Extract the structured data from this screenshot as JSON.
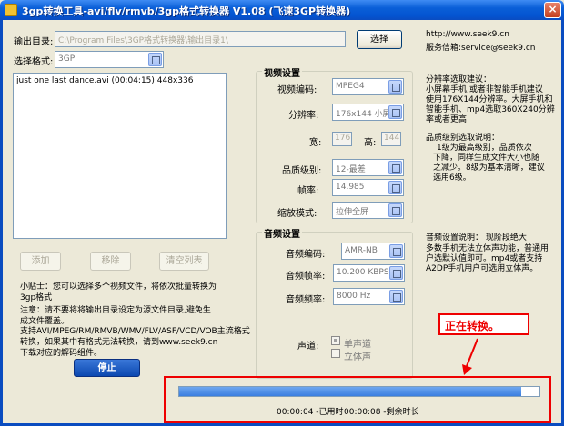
{
  "window": {
    "title": "3gp转换工具-avi/flv/rmvb/3gp格式转换器 V1.08 (飞速3GP转换器)",
    "close_glyph": "×"
  },
  "output": {
    "label": "输出目录:",
    "path": "C:\\Program Files\\3GP格式转换器\\输出目录1\\",
    "browse": "选择"
  },
  "site": {
    "url": "http://www.seek9.cn",
    "email": "服务信箱:service@seek9.cn"
  },
  "format": {
    "label": "选择格式:",
    "value": "3GP"
  },
  "files": [
    "just one last dance.avi (00:04:15) 448x336"
  ],
  "buttons": {
    "add": "添加",
    "remove": "移除",
    "clear": "清空列表",
    "stop": "停止"
  },
  "tips": {
    "line1": "小贴士：您可以选择多个视频文件，将依次批量转换为",
    "line2": "3gp格式",
    "line3": "注意：请不要将将输出目录设定为源文件目录,避免生",
    "line4": "成文件覆盖。",
    "line5": "支持AVI/MPEG/RM/RMVB/WMV/FLV/ASF/VCD/VOB主流格式",
    "line6": "转换，如果其中有格式无法转换，请到www.seek9.cn",
    "line7": "下载对应的解码组件。"
  },
  "video": {
    "title": "视频设置",
    "codec_label": "视频编码:",
    "codec": "MPEG4",
    "res_label": "分辨率:",
    "res": "176x144  小屏",
    "width_label": "宽:",
    "width": "176",
    "height_label": "高:",
    "height": "144",
    "quality_label": "品质级别:",
    "quality": "12-最差",
    "fps_label": "帧率:",
    "fps": "14.985",
    "scale_label": "缩放模式:",
    "scale": "拉伸全屏"
  },
  "audio": {
    "title": "音频设置",
    "codec_label": "音频编码:",
    "codec": "AMR-NB",
    "bitrate_label": "音频帧率:",
    "bitrate": "10.200 KBPS",
    "freq_label": "音频频率:",
    "freq": "8000 Hz",
    "channel_label": "声道:",
    "mono": "单声道",
    "stereo": "立体声"
  },
  "help": {
    "res1": "分辨率选取建议：",
    "res2": "小屏幕手机,或者非智能手机建议",
    "res3": "使用176X144分辨率。大屏手机和",
    "res4": "智能手机、mp4选取360X240分辨",
    "res5": "率或者更高",
    "q1": "品质级别选取说明：",
    "q2": "1级为最高级别，品质依次",
    "q3": "下降，同样生成文件大小也随",
    "q4": "之减少。8级为基本清晰，建议",
    "q5": "选用6级。",
    "a1": "音频设置说明：   现阶段绝大",
    "a2": "多数手机无法立体声功能，普通用",
    "a3": "户选默认值即可。mp4或者支持",
    "a4": "A2DP手机用户可选用立体声。"
  },
  "progress": {
    "fraction": 0.95,
    "elapsed": "00:00:04 -已用时",
    "remaining": "00:00:08 -剩余时长"
  },
  "status": "正在转换。",
  "colors": {
    "accent_red": "#e00000",
    "title_blue": "#0a5fd8"
  }
}
